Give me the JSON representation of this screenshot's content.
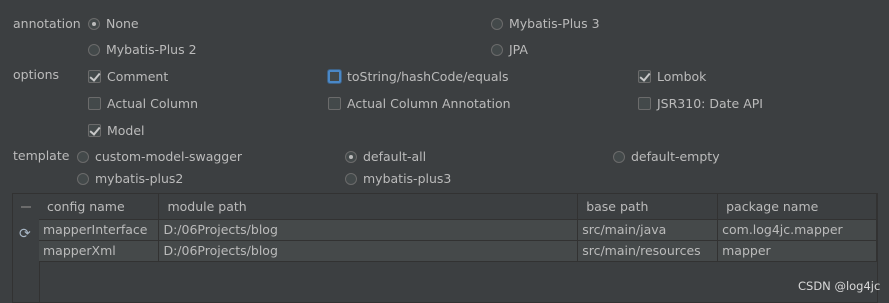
{
  "annotation": {
    "label": "annotation",
    "options": [
      {
        "label": "None",
        "selected": true
      },
      {
        "label": "Mybatis-Plus 3",
        "selected": false
      },
      {
        "label": "Mybatis-Plus 2",
        "selected": false
      },
      {
        "label": "JPA",
        "selected": false
      }
    ]
  },
  "options": {
    "label": "options",
    "items": [
      {
        "label": "Comment",
        "checked": true
      },
      {
        "label": "toString/hashCode/equals",
        "checked": false
      },
      {
        "label": "Lombok",
        "checked": true
      },
      {
        "label": "Actual Column",
        "checked": false
      },
      {
        "label": "Actual Column Annotation",
        "checked": false
      },
      {
        "label": "JSR310: Date API",
        "checked": false
      },
      {
        "label": "Model",
        "checked": true
      }
    ]
  },
  "template": {
    "label": "template",
    "options": [
      {
        "label": "custom-model-swagger",
        "selected": false
      },
      {
        "label": "default-all",
        "selected": true
      },
      {
        "label": "default-empty",
        "selected": false
      },
      {
        "label": "mybatis-plus2",
        "selected": false
      },
      {
        "label": "mybatis-plus3",
        "selected": false
      }
    ]
  },
  "table": {
    "columns": [
      "config name",
      "module path",
      "base path",
      "package name"
    ],
    "rows": [
      [
        "mapperInterface",
        "D:/06Projects/blog",
        "src/main/java",
        "com.log4jc.mapper"
      ],
      [
        "mapperXml",
        "D:/06Projects/blog",
        "src/main/resources",
        "mapper"
      ]
    ]
  },
  "watermark": "CSDN @log4jc"
}
